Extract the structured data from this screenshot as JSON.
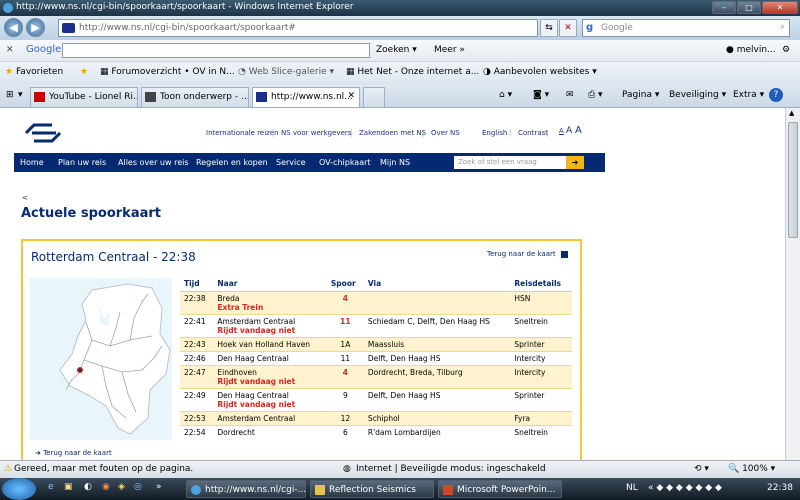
{
  "window": {
    "title": "http://www.ns.nl/cgi-bin/spoorkaart/spoorkaart - Windows Internet Explorer"
  },
  "address": {
    "url": "http://www.ns.nl/cgi-bin/spoorkaart/spoorkaart#",
    "search_placeholder": "Google"
  },
  "google_bar": {
    "logo": "Google",
    "search_label": "Zoeken",
    "more_label": "Meer",
    "user": "melvin..."
  },
  "favorites": {
    "label": "Favorieten",
    "items": [
      "Forumoverzicht • OV in N...",
      "Web Slice-galerie",
      "Het Net - Onze internet a...",
      "Aanbevolen websites"
    ]
  },
  "tabs": [
    "YouTube - Lionel Ri...",
    "Toon onderwerp - ...",
    "http://www.ns.nl..."
  ],
  "commands": {
    "page": "Pagina",
    "safety": "Beveiliging",
    "extra": "Extra"
  },
  "site": {
    "top_links": [
      "Internationale reizen",
      "NS voor werkgevers",
      "Zakendoen met NS",
      "Over NS"
    ],
    "lang": "English",
    "contrast": "Contrast",
    "sizes": [
      "A",
      "A",
      "A"
    ],
    "nav": [
      "Home",
      "Plan uw reis",
      "Alles over uw reis",
      "Regelen en kopen",
      "Service",
      "OV-chipkaart",
      "Mijn NS"
    ],
    "search_placeholder": "Zoek of stel een vraag",
    "back_arrow": "<",
    "title": "Actuele spoorkaart"
  },
  "panel": {
    "station": "Rotterdam Centraal -  22:38",
    "back_to_map": "Terug naar de kaart",
    "map_link": "Terug naar de kaart",
    "headers": [
      "Tijd",
      "Naar",
      "Spoor",
      "Via",
      "Reisdetails"
    ],
    "rows": [
      {
        "time": "22:38",
        "to": "Breda",
        "note": "Extra Trein",
        "track": "4",
        "track_changed": true,
        "via": "",
        "type": "HSN"
      },
      {
        "time": "22:41",
        "to": "Amsterdam Centraal",
        "note": "Rijdt vandaag niet",
        "track": "11",
        "track_changed": true,
        "via": "Schiedam C, Delft, Den Haag HS",
        "type": "Sneltrein"
      },
      {
        "time": "22:43",
        "to": "Hoek van Holland Haven",
        "note": "",
        "track": "1A",
        "track_changed": false,
        "via": "Maassluis",
        "type": "Sprinter"
      },
      {
        "time": "22:46",
        "to": "Den Haag Centraal",
        "note": "",
        "track": "11",
        "track_changed": false,
        "via": "Delft, Den Haag HS",
        "type": "Intercity"
      },
      {
        "time": "22:47",
        "to": "Eindhoven",
        "note": "Rijdt vandaag niet",
        "track": "4",
        "track_changed": true,
        "via": "Dordrecht, Breda, Tilburg",
        "type": "Intercity"
      },
      {
        "time": "22:49",
        "to": "Den Haag Centraal",
        "note": "Rijdt vandaag niet",
        "track": "9",
        "track_changed": false,
        "via": "Delft, Den Haag HS",
        "type": "Sprinter"
      },
      {
        "time": "22:53",
        "to": "Amsterdam Centraal",
        "note": "",
        "track": "12",
        "track_changed": false,
        "via": "Schiphol",
        "type": "Fyra"
      },
      {
        "time": "22:54",
        "to": "Dordrecht",
        "note": "",
        "track": "6",
        "track_changed": false,
        "via": "R'dam Lombardijen",
        "type": "Sneltrein"
      }
    ]
  },
  "status": {
    "message": "Gereed, maar met fouten op de pagina.",
    "zone": "Internet | Beveiligde modus: ingeschakeld",
    "zoom": "100%"
  },
  "taskbar": {
    "items": [
      "http://www.ns.nl/cgi-...",
      "Reflection Seismics",
      "Microsoft PowerPoin..."
    ],
    "lang": "NL",
    "clock": "22:38"
  }
}
